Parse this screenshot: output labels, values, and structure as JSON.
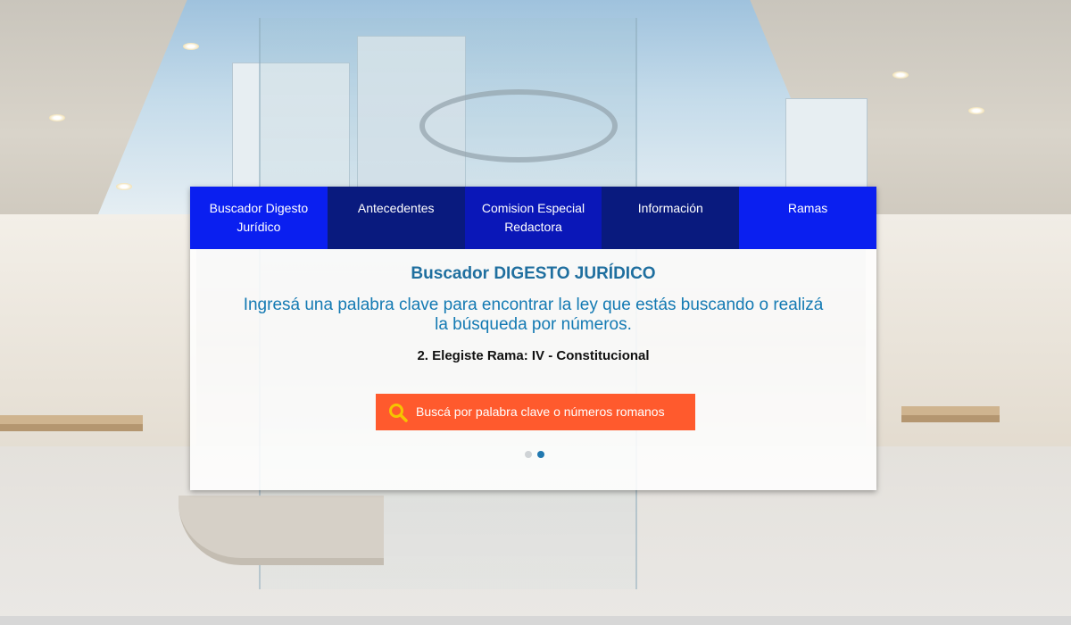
{
  "nav": {
    "tabs": [
      {
        "label": "Buscador Digesto Jurídico"
      },
      {
        "label": "Antecedentes"
      },
      {
        "label": "Comision Especial Redactora"
      },
      {
        "label": "Información"
      },
      {
        "label": "Ramas"
      }
    ]
  },
  "main": {
    "title": "Buscador DIGESTO JURÍDICO",
    "subtitle": "Ingresá una palabra clave para encontrar la ley que estás buscando o realizá la búsqueda por números.",
    "rama": "2. Elegiste Rama: IV - Constitucional",
    "search": {
      "placeholder": "Buscá por palabra clave o números romanos",
      "icon": "search-icon"
    },
    "carousel": {
      "slide_count": 2,
      "active_index": 1
    }
  },
  "colors": {
    "nav_bright": "#0a1ff0",
    "nav_dark": "#091a7e",
    "title": "#1f6f9f",
    "subtitle": "#147ab3",
    "search_bg": "#ff5a2d",
    "search_icon": "#f5c400"
  }
}
